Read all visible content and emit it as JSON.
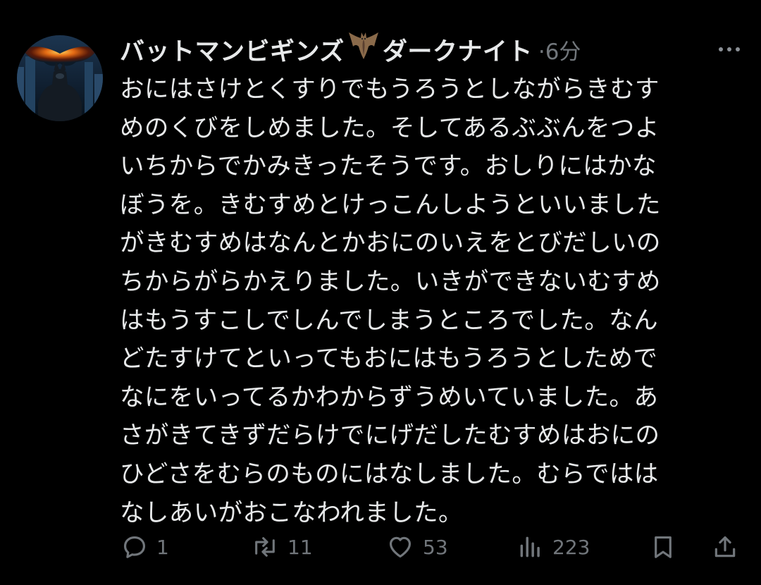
{
  "post": {
    "author": {
      "name_part1": "バットマンビギンズ",
      "name_part2": "ダークナイト",
      "emoji": "bat"
    },
    "separator": "·",
    "timestamp": "6分",
    "text": "おにはさけとくすりでもうろうとしながらきむす\nめのくびをしめました。そしてあるぶぶんをつよ\nいちからでかみきったそうです。おしりにはかな\nぼうを。きむすめとけっこんしようといいました\nがきむすめはなんとかおにのいえをとびだしいの\nちからがらかえりました。いきができないむすめ\nはもうすこしでしんでしまうところでした。なん\nどたすけてといってもおにはもうろうとしためで\nなにをいってるかわからずうめいていました。あ\nさがきてきずだらけでにげだしたむすめはおにの\nひどさをむらのものにはなしました。むらではは\nなしあいがおこなわれました。",
    "stats": {
      "replies": "1",
      "reposts": "11",
      "likes": "53",
      "views": "223"
    }
  },
  "icons": {
    "reply": "speech-bubble-icon",
    "repost": "repost-arrows-icon",
    "like": "heart-icon",
    "views": "bar-chart-icon",
    "bookmark": "bookmark-icon",
    "share": "share-upload-icon",
    "more": "more-dots-icon"
  },
  "colors": {
    "background": "#000000",
    "text": "#e7e9ea",
    "muted": "#71767b"
  }
}
